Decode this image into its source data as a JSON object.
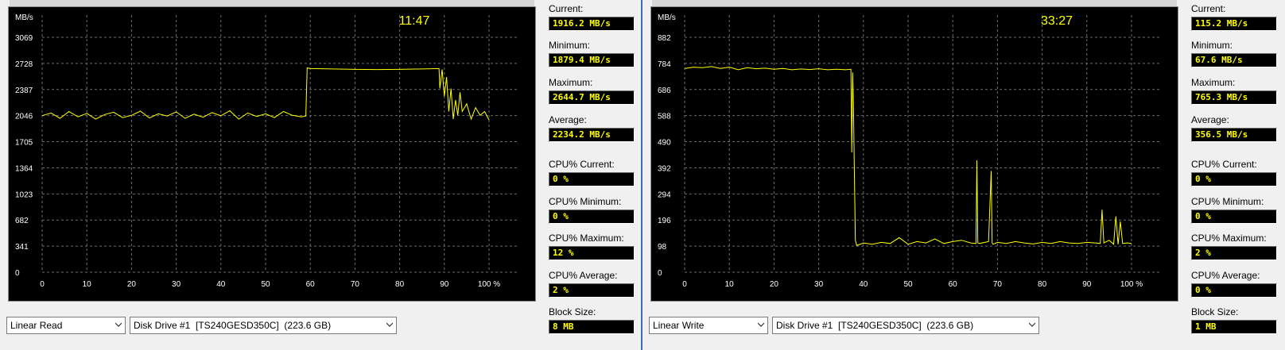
{
  "colors": {
    "graph_bg": "#000000",
    "grid": "#6e6e6e",
    "line": "#ffff00",
    "axis_text": "#ffffff",
    "time_text": "#ffff00"
  },
  "icons": {
    "dropdown": "chevron-down-icon"
  },
  "panels": [
    {
      "time": "11:47",
      "unit": "MB/s",
      "y_ticks": [
        "3069",
        "2728",
        "2387",
        "2046",
        "1705",
        "1364",
        "1023",
        "682",
        "341",
        "0"
      ],
      "x_ticks": [
        "0",
        "10",
        "20",
        "30",
        "40",
        "50",
        "60",
        "70",
        "80",
        "90",
        "100 %"
      ],
      "mode": "Linear Read",
      "drive": "Disk Drive #1  [TS240GESD350C]  (223.6 GB)",
      "stats": [
        {
          "label": "Current:",
          "value": "1916.2 MB/s"
        },
        {
          "label": "Minimum:",
          "value": "1879.4 MB/s"
        },
        {
          "label": "Maximum:",
          "value": "2644.7 MB/s"
        },
        {
          "label": "Average:",
          "value": "2234.2 MB/s"
        },
        {
          "label": "CPU% Current:",
          "value": "0 %"
        },
        {
          "label": "CPU% Minimum:",
          "value": "0 %"
        },
        {
          "label": "CPU% Maximum:",
          "value": "12 %"
        },
        {
          "label": "CPU% Average:",
          "value": "2 %"
        },
        {
          "label": "Block Size:",
          "value": "8 MB"
        }
      ]
    },
    {
      "time": "33:27",
      "unit": "MB/s",
      "y_ticks": [
        "882",
        "784",
        "686",
        "588",
        "490",
        "392",
        "294",
        "196",
        "98",
        "0"
      ],
      "x_ticks": [
        "0",
        "10",
        "20",
        "30",
        "40",
        "50",
        "60",
        "70",
        "80",
        "90",
        "100 %"
      ],
      "mode": "Linear Write",
      "drive": "Disk Drive #1  [TS240GESD350C]  (223.6 GB)",
      "stats": [
        {
          "label": "Current:",
          "value": "115.2 MB/s"
        },
        {
          "label": "Minimum:",
          "value": "67.6 MB/s"
        },
        {
          "label": "Maximum:",
          "value": "765.3 MB/s"
        },
        {
          "label": "Average:",
          "value": "356.5 MB/s"
        },
        {
          "label": "CPU% Current:",
          "value": "0 %"
        },
        {
          "label": "CPU% Minimum:",
          "value": "0 %"
        },
        {
          "label": "CPU% Maximum:",
          "value": "2 %"
        },
        {
          "label": "CPU% Average:",
          "value": "0 %"
        },
        {
          "label": "Block Size:",
          "value": "1 MB"
        }
      ]
    }
  ],
  "chart_data": [
    {
      "type": "line",
      "title": "",
      "xlabel": "",
      "ylabel": "MB/s",
      "xlim": [
        0,
        100
      ],
      "ylim": [
        0,
        3069
      ],
      "grid": true,
      "series": [
        {
          "x": [
            0,
            2,
            4,
            6,
            8,
            10,
            12,
            14,
            16,
            18,
            20,
            22,
            24,
            26,
            28,
            30,
            32,
            34,
            36,
            38,
            40,
            42,
            44,
            46,
            48,
            50,
            52,
            54,
            56,
            58,
            59,
            59.3,
            60,
            65,
            70,
            75,
            80,
            85,
            88.8,
            89,
            89.5,
            90,
            90.5,
            91,
            91.5,
            92,
            92.5,
            93,
            93.5,
            94,
            95,
            96,
            97,
            98,
            99,
            100
          ],
          "y": [
            2046,
            2080,
            2010,
            2100,
            2030,
            2075,
            2000,
            2060,
            2090,
            2020,
            2050,
            2105,
            2015,
            2070,
            2040,
            2095,
            2010,
            2065,
            2025,
            2085,
            2045,
            2110,
            2000,
            2080,
            2035,
            2070,
            2020,
            2100,
            2050,
            2030,
            2040,
            2670,
            2660,
            2655,
            2650,
            2648,
            2650,
            2655,
            2660,
            2400,
            2650,
            2300,
            2550,
            2100,
            2400,
            2000,
            2250,
            2050,
            2350,
            2100,
            2200,
            2000,
            2150,
            2050,
            2100,
            1990
          ]
        }
      ]
    },
    {
      "type": "line",
      "title": "",
      "xlabel": "",
      "ylabel": "MB/s",
      "xlim": [
        0,
        100
      ],
      "ylim": [
        0,
        882
      ],
      "grid": true,
      "series": [
        {
          "x": [
            0,
            2,
            4,
            6,
            8,
            10,
            12,
            14,
            16,
            18,
            20,
            22,
            24,
            26,
            28,
            30,
            32,
            34,
            36,
            37.2,
            37.4,
            37.6,
            37.8,
            38.2,
            38.5,
            40,
            42,
            44,
            46,
            48,
            50,
            52,
            54,
            56,
            58,
            60,
            62,
            64,
            65.2,
            65.4,
            65.6,
            66,
            68,
            68.6,
            68.8,
            69,
            70,
            72,
            74,
            76,
            78,
            80,
            82,
            84,
            86,
            88,
            90,
            92,
            93,
            93.4,
            93.8,
            95,
            96,
            96.5,
            97,
            97.5,
            98,
            99,
            100
          ],
          "y": [
            765,
            770,
            768,
            772,
            765,
            770,
            760,
            768,
            764,
            766,
            762,
            765,
            760,
            763,
            761,
            764,
            760,
            762,
            760,
            762,
            450,
            750,
            600,
            120,
            100,
            110,
            105,
            112,
            108,
            130,
            105,
            115,
            110,
            125,
            108,
            115,
            120,
            110,
            108,
            420,
            110,
            108,
            115,
            380,
            110,
            105,
            112,
            108,
            115,
            110,
            106,
            112,
            108,
            115,
            110,
            108,
            112,
            110,
            108,
            235,
            110,
            120,
            105,
            210,
            105,
            190,
            108,
            110,
            108
          ]
        }
      ]
    }
  ]
}
